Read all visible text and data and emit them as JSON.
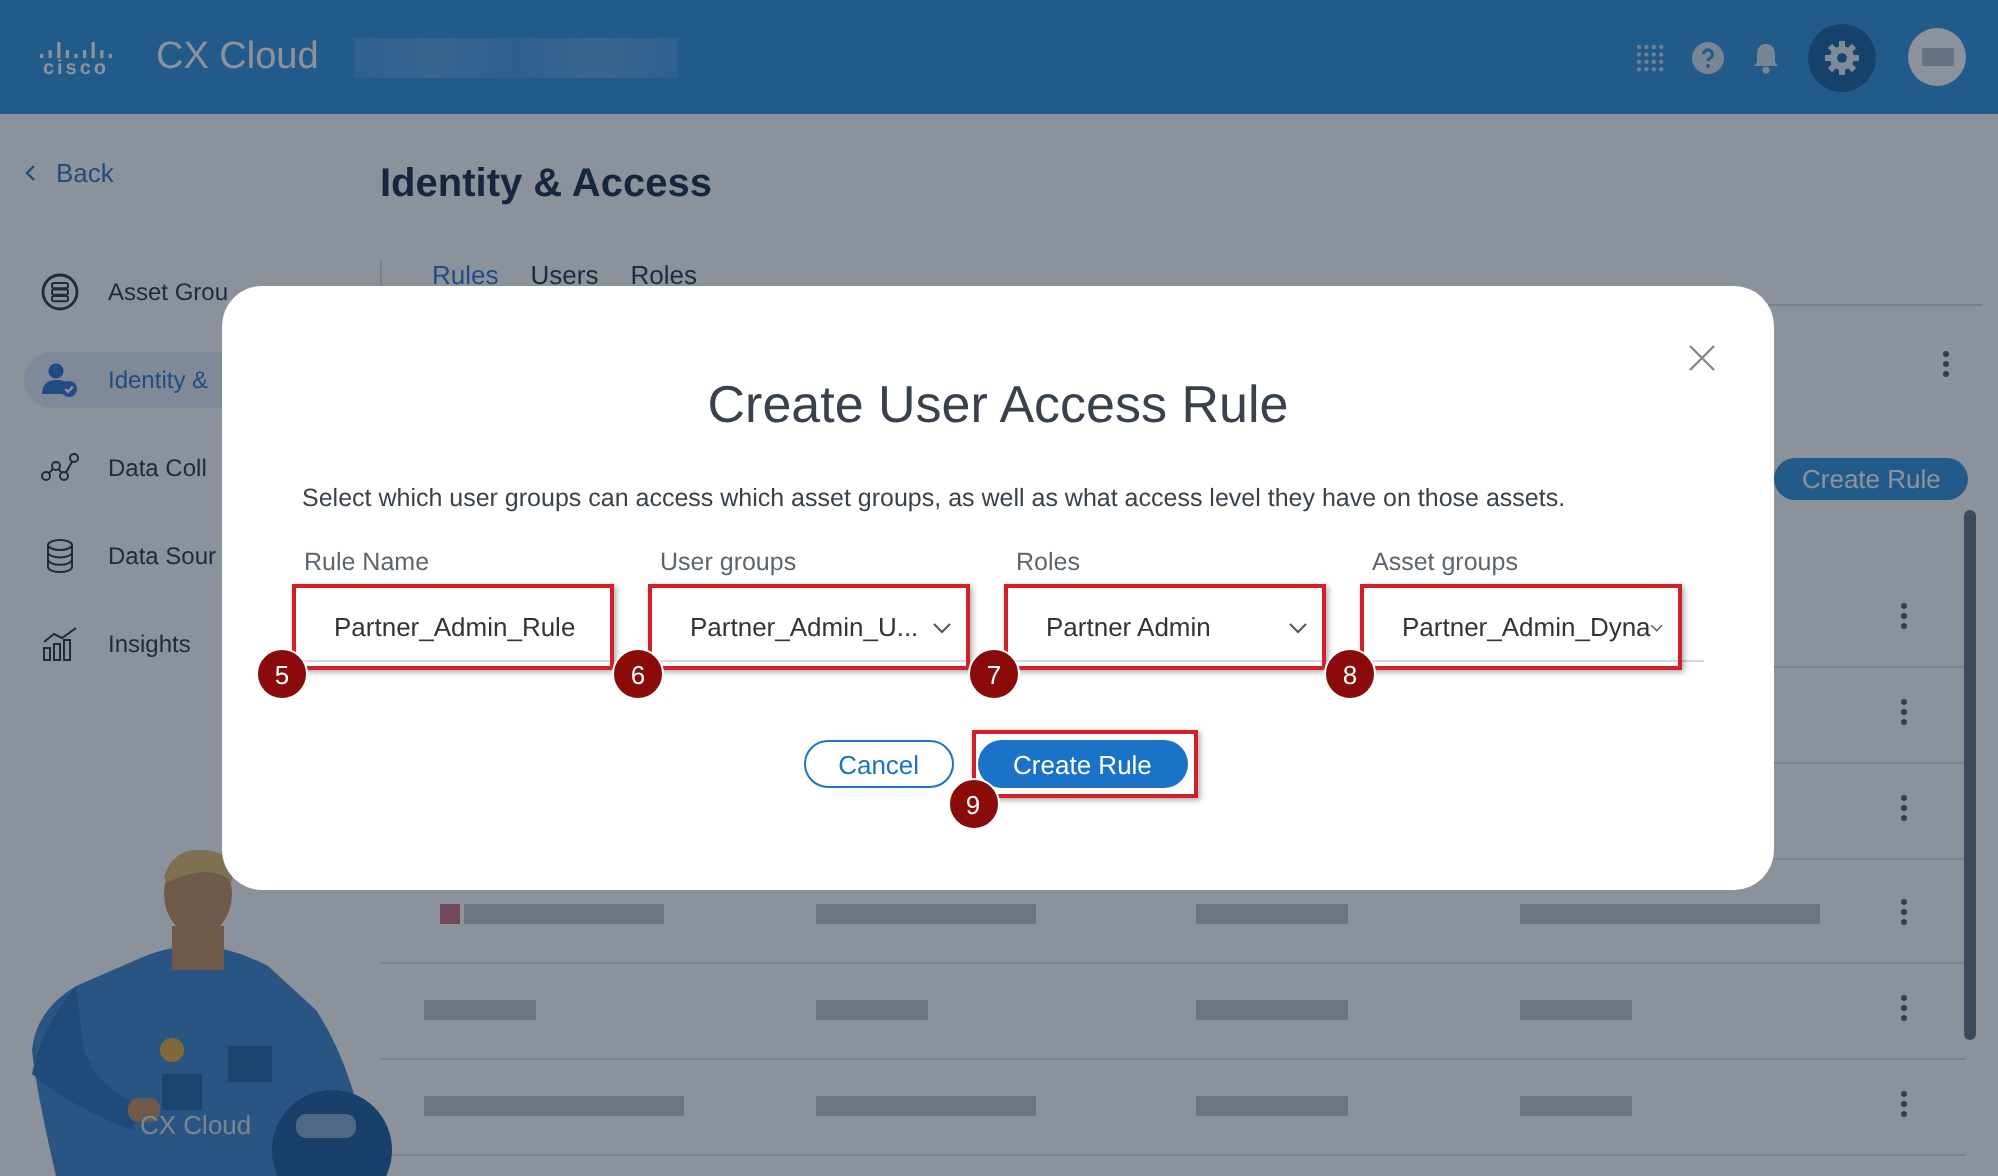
{
  "header": {
    "logo_text": "cisco",
    "product": "CX Cloud",
    "settings_selected": true
  },
  "sidebar": {
    "back": "Back",
    "items": [
      {
        "label": "Asset Grou",
        "selected": false
      },
      {
        "label": "Identity &",
        "selected": true
      },
      {
        "label": "Data Coll",
        "selected": false
      },
      {
        "label": "Data Sour",
        "selected": false
      },
      {
        "label": "Insights",
        "selected": false
      }
    ]
  },
  "page": {
    "title": "Identity & Access",
    "tabs": [
      {
        "label": "Rules",
        "selected": true
      },
      {
        "label": "Users",
        "selected": false
      },
      {
        "label": "Roles",
        "selected": false
      }
    ],
    "create_button": "Create Rule"
  },
  "mascot": {
    "caption": "CX Cloud"
  },
  "dialog": {
    "title": "Create User Access Rule",
    "description": "Select which user groups can access which asset groups, as well as what access level they have on those assets.",
    "fields": [
      {
        "label": "Rule Name",
        "value": "Partner_Admin_Rule",
        "kind": "text",
        "callout": "5"
      },
      {
        "label": "User groups",
        "value": "Partner_Admin_U...",
        "kind": "select",
        "callout": "6"
      },
      {
        "label": "Roles",
        "value": "Partner Admin",
        "kind": "select",
        "callout": "7"
      },
      {
        "label": "Asset groups",
        "value": "Partner_Admin_Dyna",
        "kind": "select",
        "callout": "8"
      }
    ],
    "buttons": [
      {
        "label": "Cancel",
        "kind": "secondary"
      },
      {
        "label": "Create Rule",
        "kind": "primary",
        "callout": "9"
      }
    ]
  }
}
